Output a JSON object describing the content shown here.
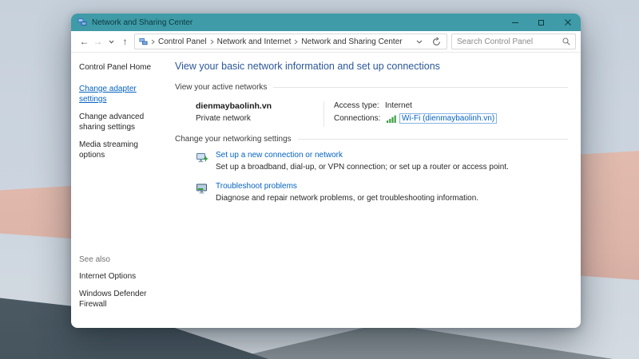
{
  "window": {
    "title": "Network and Sharing Center"
  },
  "toolbar": {
    "back": "←",
    "forward": "→",
    "up": "↑",
    "breadcrumb": {
      "items": [
        "Control Panel",
        "Network and Internet",
        "Network and Sharing Center"
      ]
    },
    "search": {
      "placeholder": "Search Control Panel"
    }
  },
  "sidebar": {
    "home": "Control Panel Home",
    "links": [
      "Change adapter settings",
      "Change advanced sharing settings",
      "Media streaming options"
    ],
    "see_also": {
      "label": "See also",
      "links": [
        "Internet Options",
        "Windows Defender Firewall"
      ]
    }
  },
  "main": {
    "heading": "View your basic network information and set up connections",
    "active_networks": {
      "section_label": "View your active networks",
      "network": {
        "name": "dienmaybaolinh.vn",
        "type": "Private network",
        "access_type_label": "Access type:",
        "access_type_value": "Internet",
        "connections_label": "Connections:",
        "connection_link": "Wi-Fi (dienmaybaolinh.vn)"
      }
    },
    "settings": {
      "section_label": "Change your networking settings",
      "items": [
        {
          "title": "Set up a new connection or network",
          "description": "Set up a broadband, dial-up, or VPN connection; or set up a router or access point."
        },
        {
          "title": "Troubleshoot problems",
          "description": "Diagnose and repair network problems, or get troubleshooting information."
        }
      ]
    }
  },
  "colors": {
    "titlebar": "#3e9ba7",
    "heading": "#2b579a",
    "link": "#0563c1",
    "wifi_green": "#3fa143"
  }
}
